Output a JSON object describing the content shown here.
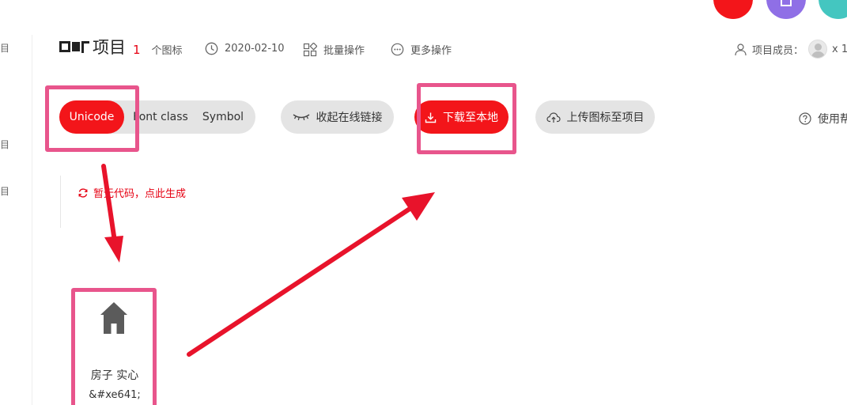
{
  "sidebar": {
    "glyphs": [
      "目",
      "目",
      "目"
    ]
  },
  "header": {
    "title_suffix": "项目",
    "icon_count": "1",
    "icon_count_label": "个图标",
    "date": "2020-02-10",
    "batch_label": "批量操作",
    "more_label": "更多操作",
    "members_label": "项目成员：",
    "members_count": "x 1"
  },
  "toolbar": {
    "tabs": [
      {
        "label": "Unicode",
        "active": true
      },
      {
        "label": "Font class",
        "active": false
      },
      {
        "label": "Symbol",
        "active": false
      }
    ],
    "collapse_label": "收起在线链接",
    "download_label": "下载至本地",
    "upload_label": "上传图标至项目",
    "help_label": "使用帮"
  },
  "code": {
    "generate_label": "暂无代码，点此生成"
  },
  "icon_card": {
    "name": "房子 实心",
    "code": "&#xe641;",
    "icon": "house-icon"
  },
  "colors": {
    "brand_red": "#f3151a",
    "highlight_pink": "#e8558c",
    "arrow_red": "#e8132b"
  }
}
